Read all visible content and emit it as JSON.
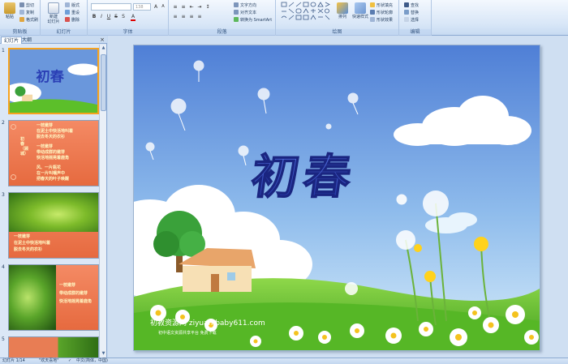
{
  "ribbon": {
    "groups": {
      "clipboard": "剪贴板",
      "slides": "幻灯片",
      "font": "字体",
      "paragraph": "段落",
      "drawing": "绘图",
      "editing": "编辑"
    },
    "clipboard": {
      "paste": "粘贴",
      "cut": "剪切",
      "copy": "复制",
      "format_painter": "格式刷"
    },
    "slides": {
      "new_slide": "新建\n幻灯片",
      "layout": "版式",
      "reset": "重设",
      "delete": "删除"
    },
    "font": {
      "name": "",
      "size": "138"
    },
    "paragraph": {
      "text_direction": "文字方向",
      "align_text": "对齐文本",
      "smartart": "转换为 SmartArt"
    },
    "drawing": {
      "arrange": "排列",
      "quick_styles": "快速样式",
      "shape_fill": "形状填充",
      "shape_outline": "形状轮廓",
      "shape_effects": "形状效果"
    },
    "editing": {
      "find": "查找",
      "replace": "替换",
      "select": "选择"
    }
  },
  "left_panel": {
    "tab_slides": "幻灯片",
    "tab_outline": "大纲",
    "slides": [
      {
        "number": "1"
      },
      {
        "number": "2",
        "lines": [
          "一枝嫩芽",
          "在泥土中快活地叫着",
          "脱去冬天的衣衫",
          "一枝嫩芽",
          "带动成群的嫩芽",
          "快活地摇晃着鹿角",
          "风、一片瓶花",
          "在一片叫嚷声中",
          "把春天的叶子唤醒"
        ],
        "side_title": "初春（顾城）"
      },
      {
        "number": "3",
        "lines": [
          "一枝嫩芽",
          "在泥土中快活地叫着",
          "脱去冬天的衣衫"
        ]
      },
      {
        "number": "4",
        "lines": [
          "一枝嫩芽",
          "带动成群的嫩芽",
          "快活地摇晃着鹿角"
        ]
      },
      {
        "number": "5"
      }
    ]
  },
  "slide": {
    "title": "初春",
    "watermark_line1": "初教资源网 ziyuan.baby611.com",
    "watermark_line2": "初中语文资源共享平台 免费下载"
  },
  "status_bar": {
    "slide_info": "幻灯片 1/14",
    "theme": "\"欢天喜地\"",
    "language": "中文(简体，中国)"
  },
  "colors": {
    "ribbon_bg": "#dbe7f6",
    "selection": "#f6a21d",
    "sky_top": "#5a86d8",
    "sky_bottom": "#cfe6f8",
    "title_blue": "#2a3fb5",
    "slide_orange": "#ec7a4f",
    "grass": "#5cbf2a"
  }
}
